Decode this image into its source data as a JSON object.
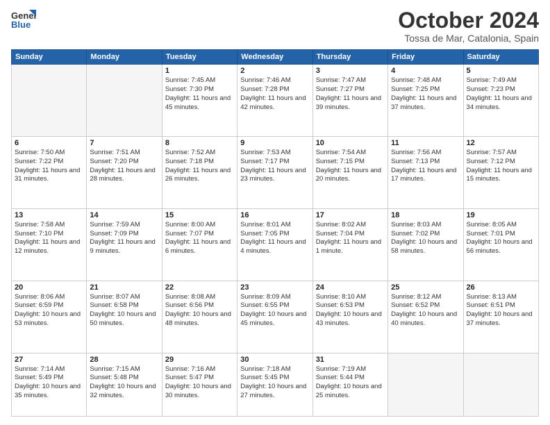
{
  "logo": {
    "line1": "General",
    "line2": "Blue"
  },
  "header": {
    "month": "October 2024",
    "location": "Tossa de Mar, Catalonia, Spain"
  },
  "weekdays": [
    "Sunday",
    "Monday",
    "Tuesday",
    "Wednesday",
    "Thursday",
    "Friday",
    "Saturday"
  ],
  "weeks": [
    [
      {
        "day": null
      },
      {
        "day": null
      },
      {
        "day": "1",
        "sunrise": "Sunrise: 7:45 AM",
        "sunset": "Sunset: 7:30 PM",
        "daylight": "Daylight: 11 hours and 45 minutes."
      },
      {
        "day": "2",
        "sunrise": "Sunrise: 7:46 AM",
        "sunset": "Sunset: 7:28 PM",
        "daylight": "Daylight: 11 hours and 42 minutes."
      },
      {
        "day": "3",
        "sunrise": "Sunrise: 7:47 AM",
        "sunset": "Sunset: 7:27 PM",
        "daylight": "Daylight: 11 hours and 39 minutes."
      },
      {
        "day": "4",
        "sunrise": "Sunrise: 7:48 AM",
        "sunset": "Sunset: 7:25 PM",
        "daylight": "Daylight: 11 hours and 37 minutes."
      },
      {
        "day": "5",
        "sunrise": "Sunrise: 7:49 AM",
        "sunset": "Sunset: 7:23 PM",
        "daylight": "Daylight: 11 hours and 34 minutes."
      }
    ],
    [
      {
        "day": "6",
        "sunrise": "Sunrise: 7:50 AM",
        "sunset": "Sunset: 7:22 PM",
        "daylight": "Daylight: 11 hours and 31 minutes."
      },
      {
        "day": "7",
        "sunrise": "Sunrise: 7:51 AM",
        "sunset": "Sunset: 7:20 PM",
        "daylight": "Daylight: 11 hours and 28 minutes."
      },
      {
        "day": "8",
        "sunrise": "Sunrise: 7:52 AM",
        "sunset": "Sunset: 7:18 PM",
        "daylight": "Daylight: 11 hours and 26 minutes."
      },
      {
        "day": "9",
        "sunrise": "Sunrise: 7:53 AM",
        "sunset": "Sunset: 7:17 PM",
        "daylight": "Daylight: 11 hours and 23 minutes."
      },
      {
        "day": "10",
        "sunrise": "Sunrise: 7:54 AM",
        "sunset": "Sunset: 7:15 PM",
        "daylight": "Daylight: 11 hours and 20 minutes."
      },
      {
        "day": "11",
        "sunrise": "Sunrise: 7:56 AM",
        "sunset": "Sunset: 7:13 PM",
        "daylight": "Daylight: 11 hours and 17 minutes."
      },
      {
        "day": "12",
        "sunrise": "Sunrise: 7:57 AM",
        "sunset": "Sunset: 7:12 PM",
        "daylight": "Daylight: 11 hours and 15 minutes."
      }
    ],
    [
      {
        "day": "13",
        "sunrise": "Sunrise: 7:58 AM",
        "sunset": "Sunset: 7:10 PM",
        "daylight": "Daylight: 11 hours and 12 minutes."
      },
      {
        "day": "14",
        "sunrise": "Sunrise: 7:59 AM",
        "sunset": "Sunset: 7:09 PM",
        "daylight": "Daylight: 11 hours and 9 minutes."
      },
      {
        "day": "15",
        "sunrise": "Sunrise: 8:00 AM",
        "sunset": "Sunset: 7:07 PM",
        "daylight": "Daylight: 11 hours and 6 minutes."
      },
      {
        "day": "16",
        "sunrise": "Sunrise: 8:01 AM",
        "sunset": "Sunset: 7:05 PM",
        "daylight": "Daylight: 11 hours and 4 minutes."
      },
      {
        "day": "17",
        "sunrise": "Sunrise: 8:02 AM",
        "sunset": "Sunset: 7:04 PM",
        "daylight": "Daylight: 11 hours and 1 minute."
      },
      {
        "day": "18",
        "sunrise": "Sunrise: 8:03 AM",
        "sunset": "Sunset: 7:02 PM",
        "daylight": "Daylight: 10 hours and 58 minutes."
      },
      {
        "day": "19",
        "sunrise": "Sunrise: 8:05 AM",
        "sunset": "Sunset: 7:01 PM",
        "daylight": "Daylight: 10 hours and 56 minutes."
      }
    ],
    [
      {
        "day": "20",
        "sunrise": "Sunrise: 8:06 AM",
        "sunset": "Sunset: 6:59 PM",
        "daylight": "Daylight: 10 hours and 53 minutes."
      },
      {
        "day": "21",
        "sunrise": "Sunrise: 8:07 AM",
        "sunset": "Sunset: 6:58 PM",
        "daylight": "Daylight: 10 hours and 50 minutes."
      },
      {
        "day": "22",
        "sunrise": "Sunrise: 8:08 AM",
        "sunset": "Sunset: 6:56 PM",
        "daylight": "Daylight: 10 hours and 48 minutes."
      },
      {
        "day": "23",
        "sunrise": "Sunrise: 8:09 AM",
        "sunset": "Sunset: 6:55 PM",
        "daylight": "Daylight: 10 hours and 45 minutes."
      },
      {
        "day": "24",
        "sunrise": "Sunrise: 8:10 AM",
        "sunset": "Sunset: 6:53 PM",
        "daylight": "Daylight: 10 hours and 43 minutes."
      },
      {
        "day": "25",
        "sunrise": "Sunrise: 8:12 AM",
        "sunset": "Sunset: 6:52 PM",
        "daylight": "Daylight: 10 hours and 40 minutes."
      },
      {
        "day": "26",
        "sunrise": "Sunrise: 8:13 AM",
        "sunset": "Sunset: 6:51 PM",
        "daylight": "Daylight: 10 hours and 37 minutes."
      }
    ],
    [
      {
        "day": "27",
        "sunrise": "Sunrise: 7:14 AM",
        "sunset": "Sunset: 5:49 PM",
        "daylight": "Daylight: 10 hours and 35 minutes."
      },
      {
        "day": "28",
        "sunrise": "Sunrise: 7:15 AM",
        "sunset": "Sunset: 5:48 PM",
        "daylight": "Daylight: 10 hours and 32 minutes."
      },
      {
        "day": "29",
        "sunrise": "Sunrise: 7:16 AM",
        "sunset": "Sunset: 5:47 PM",
        "daylight": "Daylight: 10 hours and 30 minutes."
      },
      {
        "day": "30",
        "sunrise": "Sunrise: 7:18 AM",
        "sunset": "Sunset: 5:45 PM",
        "daylight": "Daylight: 10 hours and 27 minutes."
      },
      {
        "day": "31",
        "sunrise": "Sunrise: 7:19 AM",
        "sunset": "Sunset: 5:44 PM",
        "daylight": "Daylight: 10 hours and 25 minutes."
      },
      {
        "day": null
      },
      {
        "day": null
      }
    ]
  ]
}
